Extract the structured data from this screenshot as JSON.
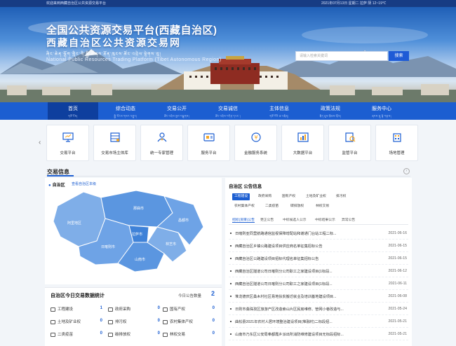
{
  "topbar": {
    "welcome": "欢迎来到西藏自治区公共资源交易平台",
    "date": "2021年07月13日  星期二  拉萨  阴  12~19℃"
  },
  "banner": {
    "title_cn": "全国公共资源交易平台(西藏自治区)",
    "title_cn2": "西藏自治区公共资源交易网",
    "title_tib": "ཞིང་ཆེན་ལྕོག་གླིང་གི་སྤྱི་ཚོགས་ཐོན་ཁུངས་ཚོང་འབྲེལ་སྟེགས་བུ།",
    "title_en": "National Public Resources Trading Platform (Tibet Autonomous Region)",
    "search_placeholder": "请输入检索关键词",
    "search_button": "搜索"
  },
  "nav": [
    {
      "label": "首页",
      "tib": "གཙོ་ངོས།"
    },
    {
      "label": "综合动态",
      "tib": "སྤྱི་ཡོངས་གསར་འགྱུར།"
    },
    {
      "label": "交易公开",
      "tib": "ཚོང་འབྲེལ་ཁྱབ་བསྒྲགས།"
    },
    {
      "label": "交易诚信",
      "tib": "ཚོང་འབྲེལ་བདེན་དཔང་།"
    },
    {
      "label": "主体信息",
      "tib": "གཙོ་བོའི་ཆ་འཕྲིན།"
    },
    {
      "label": "政策法规",
      "tib": "སྲིད་ཇུས་ཁྲིམས་སྲོལ།"
    },
    {
      "label": "服务中心",
      "tib": "ཞབས་ཞུ་ལྟེ་གནས།"
    }
  ],
  "quick": [
    {
      "label": "交易平台",
      "icon": "monitor-icon"
    },
    {
      "label": "交易市场主体库",
      "icon": "database-icon"
    },
    {
      "label": "统一专家管理",
      "icon": "expert-icon"
    },
    {
      "label": "服务平台",
      "icon": "service-icon"
    },
    {
      "label": "金融服务系统",
      "icon": "finance-icon"
    },
    {
      "label": "大数据平台",
      "icon": "bigdata-icon"
    },
    {
      "label": "监管平台",
      "icon": "supervise-icon"
    },
    {
      "label": "场地管理",
      "icon": "building-icon"
    }
  ],
  "section_title": "交易信息",
  "map": {
    "location": "自治区",
    "sublabel": "查看自治区本级",
    "regions": [
      "阿里地区",
      "那曲市",
      "日喀则市",
      "拉萨市",
      "山南市",
      "林芝市",
      "昌都市"
    ]
  },
  "stats": {
    "title": "自治区今日交易数据统计",
    "total_label": "今日公告数量",
    "total_value": "2",
    "items": [
      {
        "label": "工程建设",
        "value": "1"
      },
      {
        "label": "政府采购",
        "value": "0"
      },
      {
        "label": "国有产权",
        "value": "0"
      },
      {
        "label": "土地及矿业权",
        "value": "0"
      },
      {
        "label": "排污权",
        "value": "0"
      },
      {
        "label": "农村集体产权",
        "value": "0"
      },
      {
        "label": "二类疫苗",
        "value": "0"
      },
      {
        "label": "碳排放权",
        "value": "0"
      },
      {
        "label": "林权交易",
        "value": "0"
      }
    ]
  },
  "announcements": {
    "heading": "自治区  公告信息",
    "chips": [
      "工程建设",
      "政府采购",
      "国有产权",
      "土地及矿业权",
      "排污权",
      "农村集体产权",
      "二类疫苗",
      "碳排放权",
      "林权交易"
    ],
    "subtabs": [
      "招标(资审)公告",
      "更正公告",
      "中标候选人公示",
      "中标结果公示",
      "异常公告"
    ],
    "rows": [
      {
        "title": "日喀则亚同里航路通信监视保障增配站和谢通门台站工程二标...",
        "date": "2021-06-16"
      },
      {
        "title": "西藏自治区乡镇公路建设项目供应商名单征集招标公告",
        "date": "2021-06-15"
      },
      {
        "title": "西藏自治区公路建设项目招标代理名单征集招标公告",
        "date": "2021-06-15"
      },
      {
        "title": "西藏自治区隧道公司日喀则分公司职工之家建设项目(1标段...",
        "date": "2021-06-12"
      },
      {
        "title": "西藏自治区隧道公司日喀则分公司职工之家建设项目(1标段...",
        "date": "2021-06-11"
      },
      {
        "title": "堆龙德庆区桑木村社区易地扶贫搬迁就业及培训基地建设项目...",
        "date": "2021-06-08"
      },
      {
        "title": "日则市桑珠孜区旅游产区改造索山片区民房维修、管网小巷改造与...",
        "date": "2021-05-24"
      },
      {
        "title": "曲松县2021年农村人居环境整治建设项目(堆融村)二标段招...",
        "date": "2021-05-21"
      },
      {
        "title": "山南市乃东区公安局奉都霞乡派出所消防维修建设项目无标段招标...",
        "date": "2021-05-21"
      }
    ]
  },
  "colors": {
    "primary": "#1c5ed1",
    "nav_active": "#0e3f9e",
    "topbar": "#173c84"
  }
}
